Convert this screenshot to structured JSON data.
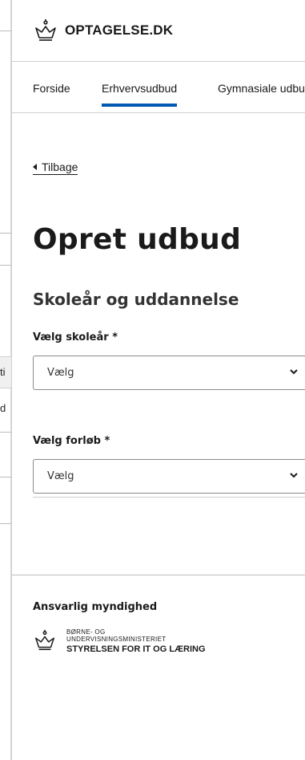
{
  "background": {
    "text_1": "ti",
    "text_2": "d"
  },
  "header": {
    "logo_icon": "crown-icon",
    "site_name": "OPTAGELSE.DK"
  },
  "nav": {
    "items": [
      {
        "label": "Forside",
        "active": false
      },
      {
        "label": "Erhvervsudbud",
        "active": true
      },
      {
        "label": "Gymnasiale udbud",
        "active": false
      }
    ]
  },
  "back": {
    "label": "Tilbage",
    "icon": "triangle-left-icon"
  },
  "page": {
    "title": "Opret udbud",
    "subtitle": "Skoleår og uddannelse"
  },
  "form": {
    "school_year": {
      "label": "Vælg skoleår *",
      "value": "Vælg"
    },
    "course": {
      "label": "Vælg forløb *",
      "value": "Vælg"
    }
  },
  "footer": {
    "heading": "Ansvarlig myndighed",
    "ministry_line1": "BØRNE- OG",
    "ministry_line2": "UNDERVISNINGSMINISTERIET",
    "agency": "STYRELSEN FOR IT OG LÆRING"
  },
  "colors": {
    "accent": "#0059b3",
    "text": "#1a1a1a",
    "border": "#8a8a8a"
  }
}
